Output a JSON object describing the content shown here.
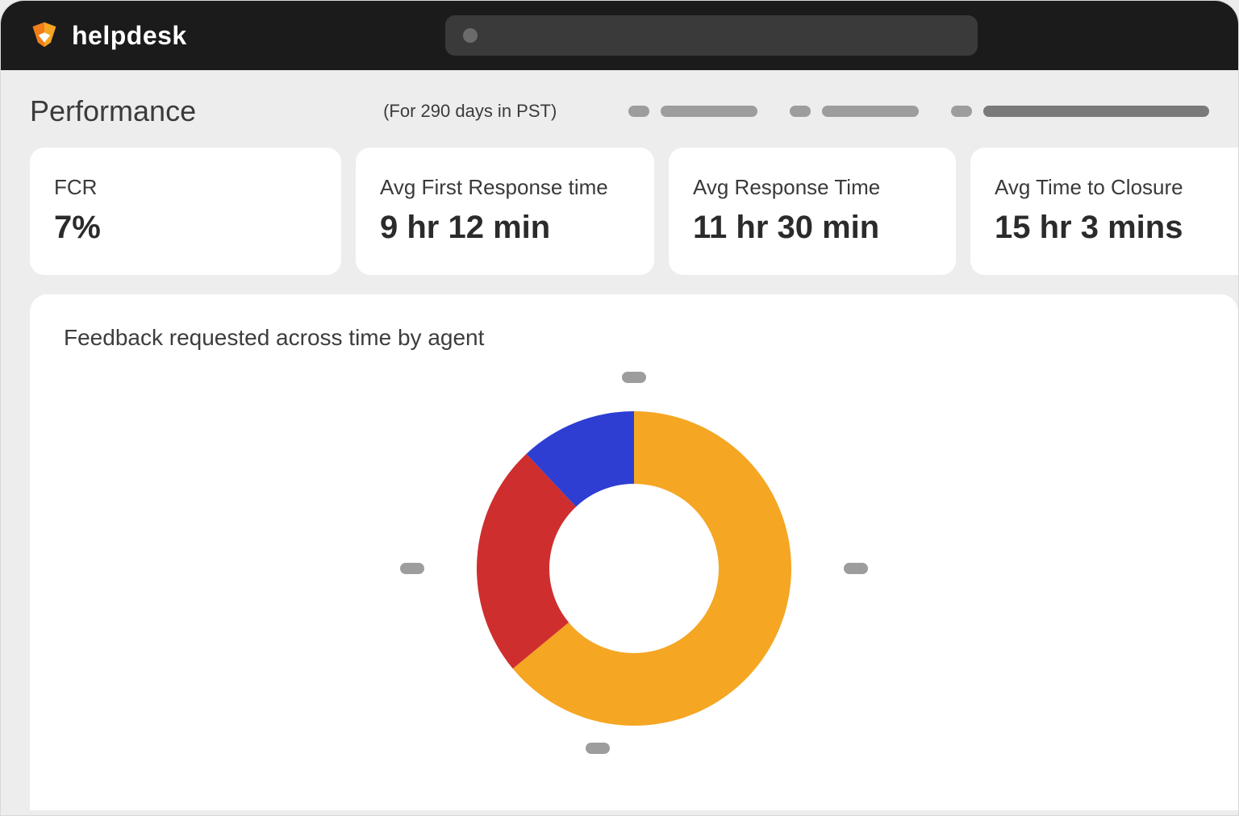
{
  "brand": {
    "name": "helpdesk"
  },
  "search": {
    "placeholder": ""
  },
  "page": {
    "title": "Performance",
    "subnote": "(For 290 days in PST)"
  },
  "metrics": [
    {
      "label": "FCR",
      "value": "7%"
    },
    {
      "label": "Avg First Response time",
      "value": "9 hr 12 min"
    },
    {
      "label": "Avg Response Time",
      "value": "11 hr 30 min"
    },
    {
      "label": "Avg Time to Closure",
      "value": "15 hr 3 mins"
    }
  ],
  "chart": {
    "title": "Feedback requested across time by agent"
  },
  "chart_data": {
    "type": "pie",
    "title": "Feedback requested across time by agent",
    "series": [
      {
        "name": "",
        "value": 64,
        "color": "#f5a623"
      },
      {
        "name": "",
        "value": 24,
        "color": "#cf2e2e"
      },
      {
        "name": "",
        "value": 12,
        "color": "#2e3ed2"
      }
    ],
    "donut": true
  },
  "colors": {
    "orange": "#f5a623",
    "red": "#cf2e2e",
    "blue": "#2e3ed2"
  }
}
